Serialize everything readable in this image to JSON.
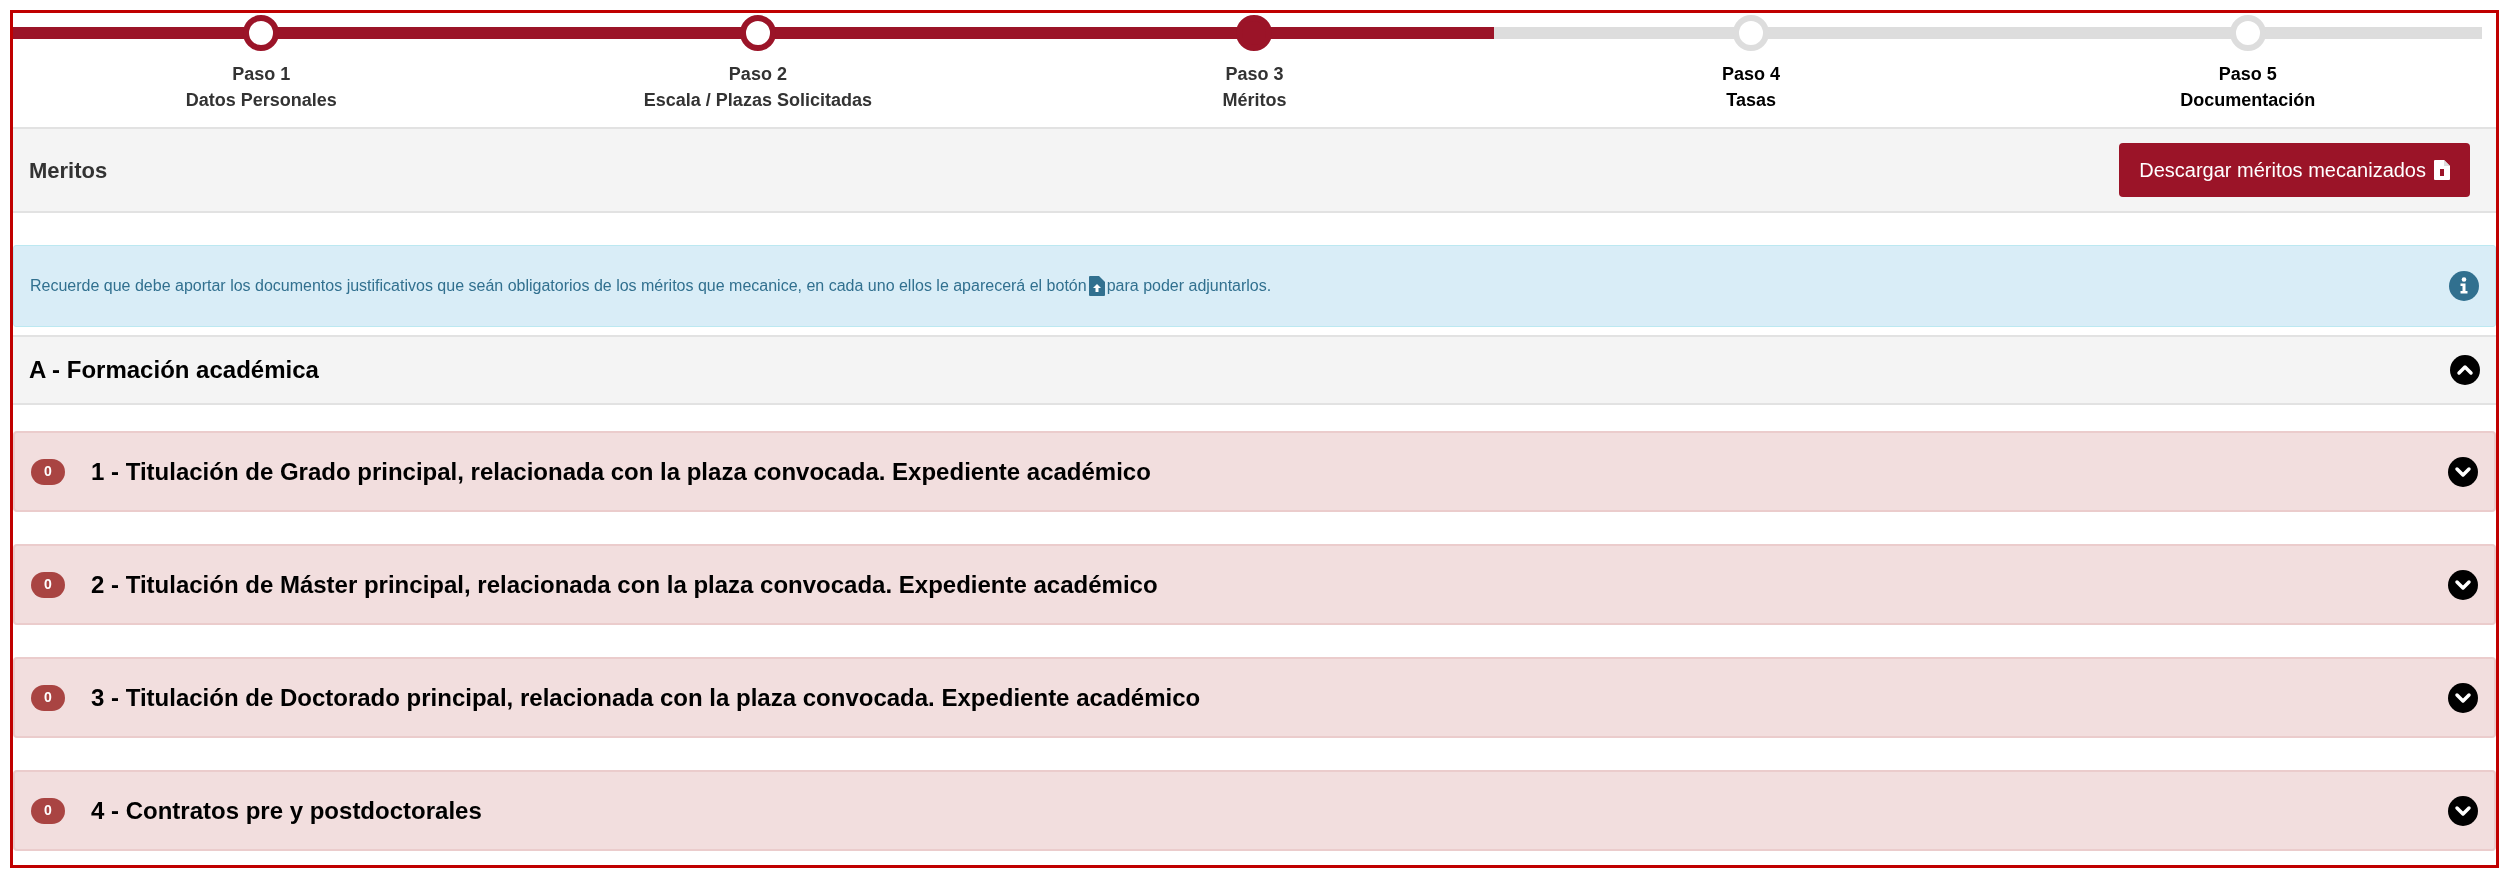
{
  "stepper": {
    "level": 0.6,
    "steps": [
      {
        "step": "Paso 1",
        "name": "Datos Personales",
        "kind": "done"
      },
      {
        "step": "Paso 2",
        "name": "Escala / Plazas Solicitadas",
        "kind": "done"
      },
      {
        "step": "Paso 3",
        "name": "Méritos",
        "kind": "current"
      },
      {
        "step": "Paso 4",
        "name": "Tasas",
        "kind": "pending"
      },
      {
        "step": "Paso 5",
        "name": "Documentación",
        "kind": "pending"
      }
    ]
  },
  "header": {
    "title": "Meritos",
    "button": "Descargar méritos mecanizados"
  },
  "alert": {
    "before": "Recuerde que debe aportar los documentos justificativos que seán obligatorios de los méritos que mecanice, en cada uno ellos le aparecerá el botón",
    "after": "para poder adjuntarlos."
  },
  "section": {
    "title": "A - Formación académica",
    "expanded": true,
    "items": [
      {
        "count": "0",
        "title": "1 - Titulación de Grado principal, relacionada con la plaza convocada. Expediente académico",
        "expanded": false
      },
      {
        "count": "0",
        "title": "2 - Titulación de Máster principal, relacionada con la plaza convocada. Expediente académico",
        "expanded": false
      },
      {
        "count": "0",
        "title": "3 - Titulación de Doctorado principal, relacionada con la plaza convocada. Expediente académico",
        "expanded": false
      },
      {
        "count": "0",
        "title": "4 - Contratos pre y postdoctorales",
        "expanded": false
      }
    ]
  }
}
